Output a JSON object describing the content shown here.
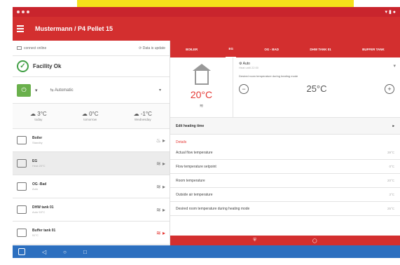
{
  "app": {
    "title": "Mustermann / P4 Pellet 15"
  },
  "left": {
    "connect": "connect online",
    "update": "Data is update",
    "facility": "Facility Ok",
    "mode": "Automatic",
    "weather": [
      {
        "temp": "3°C",
        "day": "today"
      },
      {
        "temp": "0°C",
        "day": "tomorrow"
      },
      {
        "temp": "-1°C",
        "day": "Wednesday"
      }
    ],
    "devices": [
      {
        "name": "Boiler",
        "sub": "Standby",
        "status": "♨"
      },
      {
        "name": "EG",
        "sub": "Heat 20°C",
        "status": "≋"
      },
      {
        "name": "OG -Bad",
        "sub": "Auto",
        "status": "≋"
      },
      {
        "name": "DHW tank 01",
        "sub": "Auto 53°C",
        "status": "≋"
      },
      {
        "name": "Buffer tank 01",
        "sub": "51°C",
        "status": "≋"
      }
    ]
  },
  "right": {
    "tabs": [
      "BOILER",
      "EG",
      "OG - BAD",
      "DHW TANK 01",
      "BUFFER TANK"
    ],
    "room_temp": "20°C",
    "mode": "Auto",
    "mode_sub": "Heat until 22:00",
    "desired_desc": "Desired room temperature during heating mode",
    "desired_value": "25°C",
    "edit_heating": "Edit heating time",
    "details_title": "Details",
    "details": [
      {
        "label": "Actual flow temperature",
        "value": "39°C"
      },
      {
        "label": "Flow temperature setpoint",
        "value": "0°C"
      },
      {
        "label": "Room temperature",
        "value": "20°C"
      },
      {
        "label": "Outside air temperature",
        "value": "3°C"
      },
      {
        "label": "Desired room temperature during heating mode",
        "value": "25°C"
      }
    ]
  }
}
